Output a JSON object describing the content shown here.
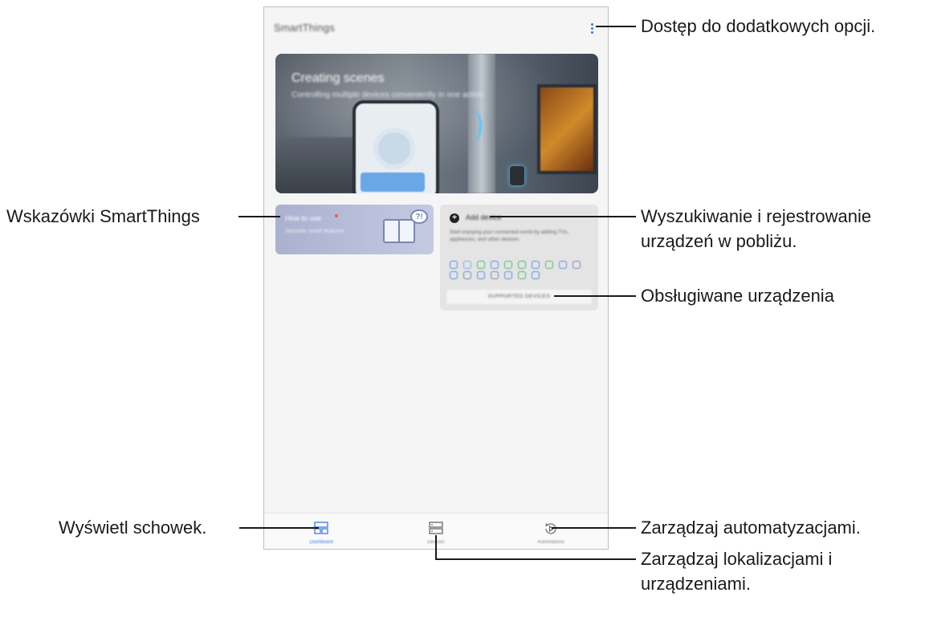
{
  "app": {
    "title": "SmartThings",
    "more_options_icon": "more-vertical-icon",
    "accent_color": "#3b7de0"
  },
  "hero": {
    "title": "Creating scenes",
    "subtitle": "Controlling multiple devices conveniently in one action"
  },
  "tips_card": {
    "title": "How to use",
    "subtitle": "Discover smart features"
  },
  "add_device_card": {
    "title": "Add device",
    "description": "Start enjoying your connected world by adding TVs, appliances, and other devices.",
    "supported_button": "SUPPORTED DEVICES"
  },
  "bottom_nav": {
    "items": [
      {
        "label": "Dashboard",
        "icon": "dashboard-icon"
      },
      {
        "label": "Devices",
        "icon": "devices-icon"
      },
      {
        "label": "Automations",
        "icon": "automations-icon"
      }
    ]
  },
  "callouts": {
    "more_options": "Dostęp do dodatkowych opcji.",
    "tips": "Wskazówki SmartThings",
    "search_register_line1": "Wyszukiwanie i rejestrowanie",
    "search_register_line2": "urządzeń w pobliżu.",
    "supported_devices": "Obsługiwane urządzenia",
    "dashboard": "Wyświetl schowek.",
    "automations": "Zarządzaj automatyzacjami.",
    "locations_line1": "Zarządzaj lokalizacjami i",
    "locations_line2": "urządzeniami."
  }
}
